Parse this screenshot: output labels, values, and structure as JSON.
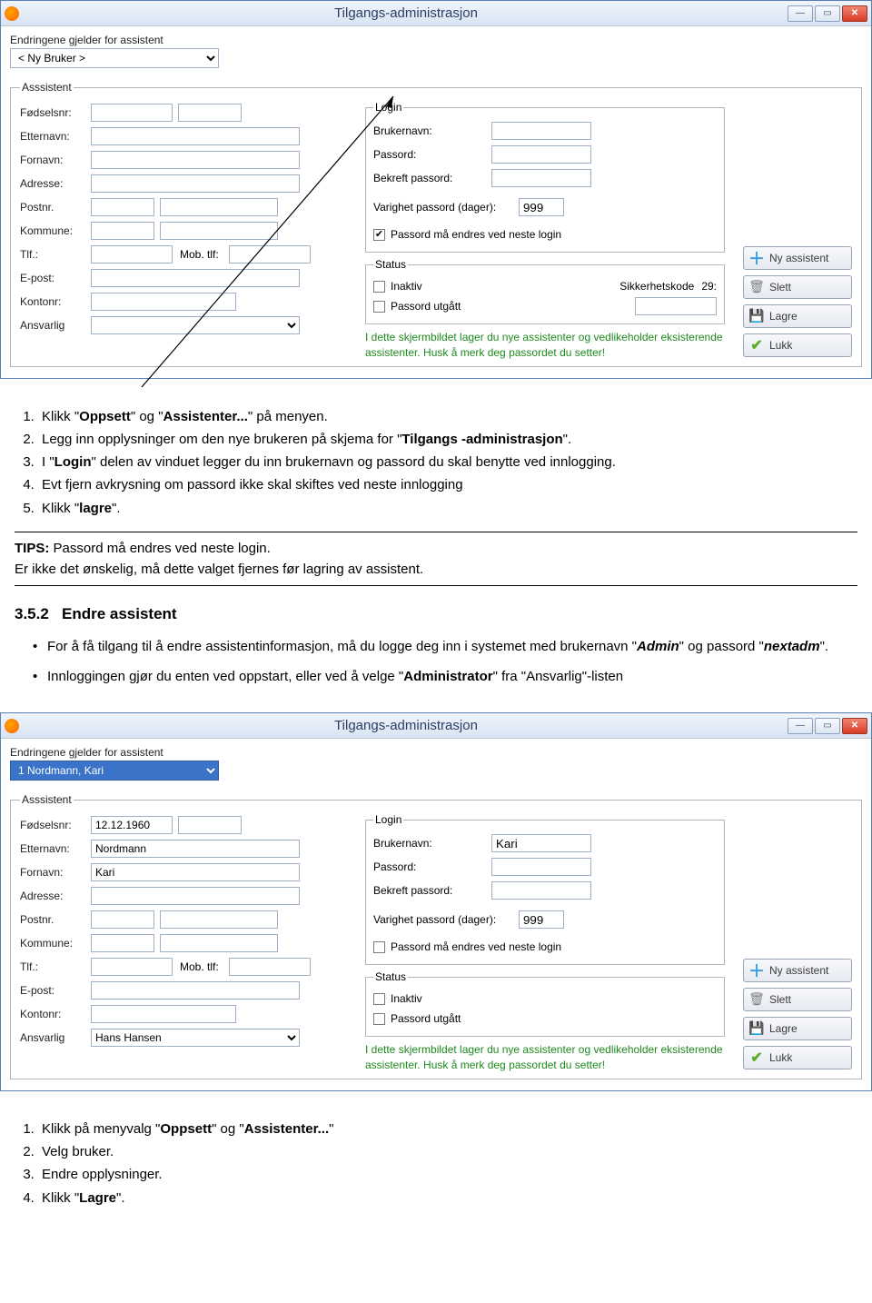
{
  "win1": {
    "title": "Tilgangs-administrasjon",
    "toplabel": "Endringene gjelder for assistent",
    "userselect": "< Ny Bruker >",
    "assistent_legend": "Asssistent",
    "fields": {
      "fodselsnr": "Fødselsnr:",
      "etternavn": "Etternavn:",
      "fornavn": "Fornavn:",
      "adresse": "Adresse:",
      "postnr": "Postnr.",
      "kommune": "Kommune:",
      "tlf": "Tlf.:",
      "mob": "Mob. tlf:",
      "epost": "E-post:",
      "kontonr": "Kontonr:",
      "ansvarlig": "Ansvarlig"
    },
    "login": {
      "legend": "Login",
      "brukernavn_lbl": "Brukernavn:",
      "passord_lbl": "Passord:",
      "bekreft_lbl": "Bekreft passord:",
      "varighet_lbl": "Varighet passord (dager):",
      "varighet_val": "999",
      "chk_change_lbl": "Passord må endres ved neste login",
      "chk_change_checked": true
    },
    "status": {
      "legend": "Status",
      "inaktiv_lbl": "Inaktiv",
      "utgatt_lbl": "Passord utgått",
      "sikkerhet_lbl": "Sikkerhetskode",
      "sikkerhet_num": "29:"
    },
    "buttons": {
      "ny": "Ny assistent",
      "slett": "Slett",
      "lagre": "Lagre",
      "lukk": "Lukk"
    },
    "infonote": "I dette skjermbildet lager du nye assistenter og vedlikeholder eksisterende assistenter. Husk å merk deg passordet du setter!"
  },
  "doc1": {
    "li1a": "Klikk \"",
    "li1b": "Oppsett",
    "li1c": "\" og \"",
    "li1d": "Assistenter...",
    "li1e": "\" på menyen.",
    "li2a": "Legg inn opplysninger om den nye brukeren på skjema for \"",
    "li2b": "Tilgangs -administrasjon",
    "li2c": "\".",
    "li3a": "I \"",
    "li3b": "Login",
    "li3c": "\" delen av vinduet legger du inn brukernavn og passord du skal benytte ved innlogging.",
    "li4": "Evt fjern avkrysning om passord ikke skal skiftes ved neste innlogging",
    "li5a": "Klikk \"",
    "li5b": "lagre",
    "li5c": "\".",
    "tips_lbl": "TIPS:",
    "tips_l1": "Passord må endres ved neste login.",
    "tips_l2": "Er ikke det ønskelig, må dette valget fjernes før lagring av assistent.",
    "sec_num": "3.5.2",
    "sec_title": "Endre assistent",
    "b1a": "For å få tilgang til å endre assistentinformasjon, må du logge deg inn i systemet med brukernavn \"",
    "b1b": "Admin",
    "b1c": "\" og passord \"",
    "b1d": "nextadm",
    "b1e": "\".",
    "b2a": "Innloggingen gjør du enten ved oppstart, eller ved å velge \"",
    "b2b": "Administrator",
    "b2c": "\" fra \"Ansvarlig\"-listen"
  },
  "win2": {
    "userselect": "1 Nordmann, Kari",
    "vals": {
      "fodselsnr": "12.12.1960",
      "etternavn": "Nordmann",
      "fornavn": "Kari",
      "ansvarlig": "Hans Hansen"
    },
    "login": {
      "brukernavn_val": "Kari",
      "chk_change_checked": false
    }
  },
  "doc2": {
    "li1a": "Klikk på menyvalg \"",
    "li1b": "Oppsett",
    "li1c": "\" og \"",
    "li1d": "Assistenter...",
    "li1e": "\"",
    "li2": "Velg bruker.",
    "li3": "Endre opplysninger.",
    "li4a": "Klikk \"",
    "li4b": "Lagre",
    "li4c": "\"."
  }
}
